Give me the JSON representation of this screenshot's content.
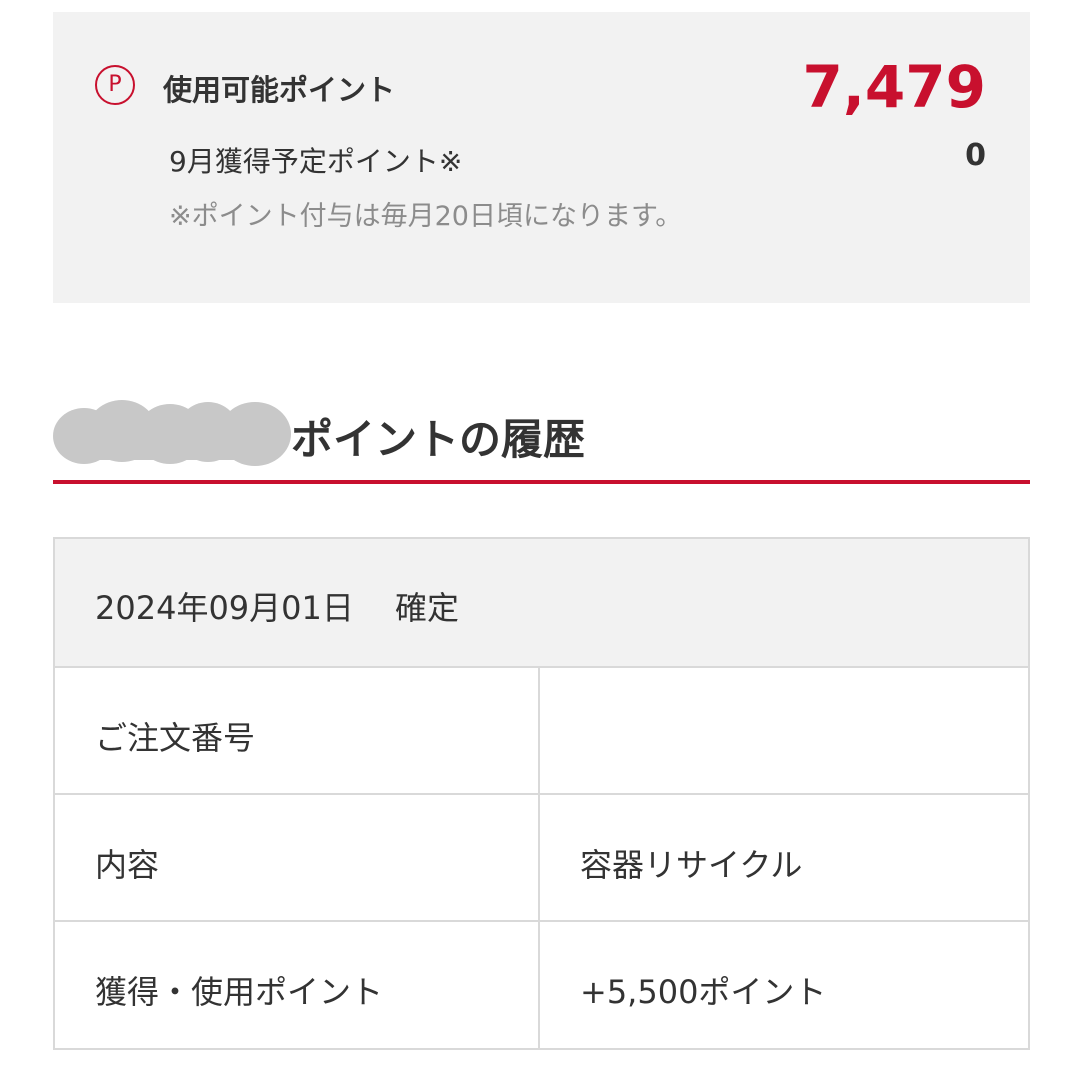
{
  "summary": {
    "point_symbol": "P",
    "available_label": "使用可能ポイント",
    "available_value": "7,479",
    "scheduled_label": "9月獲得予定ポイント※",
    "scheduled_value": "0",
    "note": "※ポイント付与は毎月20日頃になります。"
  },
  "history": {
    "title": "ポイントの履歴",
    "entry": {
      "date": "2024年09月01日",
      "status": "確定",
      "rows": [
        {
          "label": "ご注文番号",
          "value": ""
        },
        {
          "label": "内容",
          "value": "容器リサイクル"
        },
        {
          "label": "獲得・使用ポイント",
          "value": "+5,500ポイント"
        }
      ]
    }
  },
  "colors": {
    "accent": "#c8102e",
    "panel_bg": "#f2f2f2",
    "border": "#d9d9d9",
    "text": "#333333",
    "muted": "#8c8c8c"
  },
  "icons": {
    "points": "circled-p-icon"
  }
}
